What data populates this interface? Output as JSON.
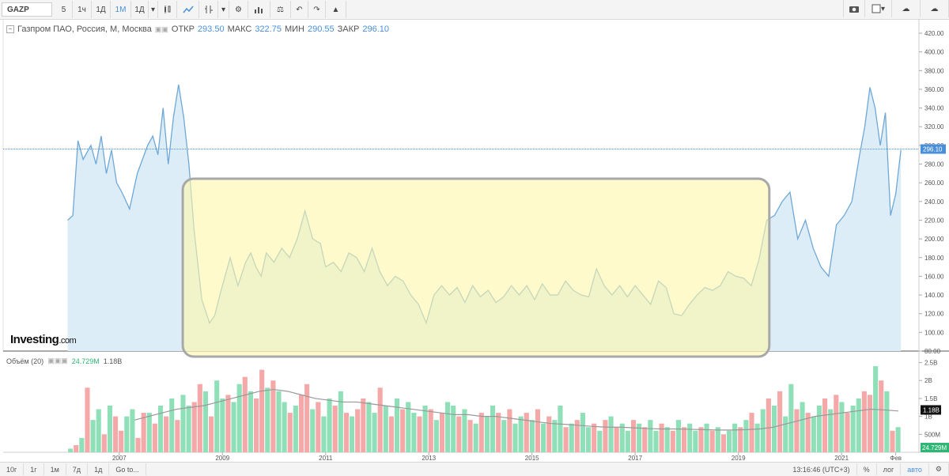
{
  "toolbar": {
    "symbol": "GAZP",
    "intervals": [
      "5",
      "1ч",
      "1Д",
      "1М",
      "1Д"
    ],
    "active_interval": "1М",
    "icons": [
      "candles-icon",
      "line-chart-icon",
      "indicators-icon",
      "settings-icon",
      "studies-icon",
      "compare-icon",
      "undo-icon",
      "redo-icon",
      "alert-icon"
    ],
    "right_icons": [
      "camera-icon",
      "layout-icon",
      "cloud-load-icon",
      "cloud-save-icon"
    ]
  },
  "legend": {
    "name": "Газпром ПАО, Россия, М, Москва",
    "open_label": "ОТКР",
    "open": "293.50",
    "high_label": "МАКС",
    "high": "322.75",
    "low_label": "МИН",
    "low": "290.55",
    "close_label": "ЗАКР",
    "close": "296.10"
  },
  "volume_legend": {
    "name": "Объём (20)",
    "value1": "24.729M",
    "value2": "1.18B"
  },
  "brand": {
    "main": "Investing",
    "suffix": ".com"
  },
  "bottom": {
    "ranges": [
      "10г",
      "1г",
      "1м",
      "7д",
      "1д",
      "Go to..."
    ],
    "time": "13:16:46 (UTC+3)",
    "percent": "%",
    "log": "лог",
    "auto": "авто"
  },
  "colors": {
    "line": "#6fa8d6",
    "area": "#dcedf8",
    "highlight_fill": "#fff6a8",
    "highlight_border": "#a8a8a8",
    "vol_up": "#8fe0b8",
    "vol_down": "#f5a8a8",
    "vol_ma": "#999999",
    "price_tag": "#4a90d9"
  },
  "chart_data": [
    {
      "type": "area",
      "title": "Газпром ПАО, Россия, М, Москва",
      "ylim": [
        80,
        420
      ],
      "y_ticks": [
        "80.00",
        "100.00",
        "120.00",
        "140.00",
        "160.00",
        "180.00",
        "200.00",
        "220.00",
        "240.00",
        "260.00",
        "280.00",
        "300.00",
        "320.00",
        "340.00",
        "360.00",
        "380.00",
        "400.00",
        "420.00"
      ],
      "x_ticks": [
        "2007",
        "2009",
        "2011",
        "2013",
        "2015",
        "2017",
        "2019",
        "2021",
        "Фев"
      ],
      "current_value": "296.10",
      "highlight_region": {
        "x_from": 2008.2,
        "x_to": 2019.6
      },
      "series": [
        {
          "x": [
            2006.0,
            2006.1,
            2006.2,
            2006.3,
            2006.45,
            2006.55,
            2006.65,
            2006.75,
            2006.85,
            2006.95,
            2007.05,
            2007.2,
            2007.35,
            2007.45,
            2007.55,
            2007.65,
            2007.75,
            2007.85,
            2007.95,
            2008.05,
            2008.15,
            2008.25,
            2008.35,
            2008.45,
            2008.6,
            2008.75,
            2008.85,
            2008.95,
            2009.05,
            2009.15,
            2009.3,
            2009.45,
            2009.55,
            2009.65,
            2009.75,
            2009.85,
            2010.0,
            2010.15,
            2010.3,
            2010.45,
            2010.6,
            2010.75,
            2010.9,
            2011.0,
            2011.15,
            2011.3,
            2011.45,
            2011.6,
            2011.75,
            2011.9,
            2012.05,
            2012.2,
            2012.35,
            2012.5,
            2012.65,
            2012.8,
            2012.95,
            2013.1,
            2013.25,
            2013.4,
            2013.55,
            2013.7,
            2013.85,
            2014.0,
            2014.15,
            2014.3,
            2014.45,
            2014.6,
            2014.75,
            2014.9,
            2015.05,
            2015.2,
            2015.35,
            2015.5,
            2015.65,
            2015.8,
            2015.95,
            2016.1,
            2016.25,
            2016.4,
            2016.55,
            2016.7,
            2016.85,
            2017.0,
            2017.15,
            2017.3,
            2017.45,
            2017.6,
            2017.75,
            2017.9,
            2018.05,
            2018.2,
            2018.35,
            2018.5,
            2018.65,
            2018.8,
            2018.95,
            2019.1,
            2019.25,
            2019.4,
            2019.55,
            2019.7,
            2019.85,
            2020.0,
            2020.15,
            2020.3,
            2020.45,
            2020.6,
            2020.75,
            2020.9,
            2021.05,
            2021.2,
            2021.35,
            2021.45,
            2021.55,
            2021.65,
            2021.75,
            2021.85,
            2021.95,
            2022.05,
            2022.15
          ],
          "y": [
            220,
            225,
            305,
            285,
            300,
            280,
            310,
            270,
            295,
            260,
            250,
            232,
            270,
            285,
            300,
            310,
            290,
            340,
            280,
            330,
            365,
            330,
            280,
            210,
            135,
            110,
            118,
            140,
            160,
            180,
            150,
            175,
            185,
            170,
            160,
            185,
            175,
            190,
            180,
            200,
            230,
            200,
            195,
            170,
            175,
            165,
            185,
            180,
            165,
            190,
            165,
            150,
            160,
            155,
            140,
            130,
            110,
            140,
            150,
            140,
            148,
            132,
            150,
            138,
            145,
            132,
            138,
            150,
            140,
            150,
            135,
            152,
            140,
            140,
            155,
            145,
            140,
            138,
            168,
            150,
            140,
            150,
            138,
            150,
            140,
            130,
            155,
            148,
            120,
            118,
            130,
            140,
            148,
            145,
            150,
            165,
            160,
            158,
            150,
            178,
            220,
            225,
            240,
            250,
            200,
            220,
            190,
            170,
            160,
            215,
            225,
            240,
            290,
            320,
            362,
            340,
            300,
            335,
            225,
            248,
            295
          ]
        }
      ]
    },
    {
      "type": "bar",
      "title": "Объём (20)",
      "ylim": [
        0,
        2.6
      ],
      "y_ticks": [
        "500M",
        "1B",
        "1.5B",
        "2B",
        "2.5B"
      ],
      "values": [
        0.1,
        0.2,
        0.4,
        1.8,
        0.9,
        1.2,
        0.5,
        1.3,
        1.0,
        0.6,
        1.0,
        1.2,
        0.4,
        1.1,
        1.1,
        0.8,
        1.3,
        1.0,
        1.5,
        0.9,
        1.6,
        1.3,
        1.4,
        1.9,
        1.7,
        1.0,
        2.0,
        1.5,
        1.6,
        1.4,
        1.9,
        2.1,
        1.7,
        1.5,
        2.3,
        1.8,
        2.0,
        1.7,
        1.4,
        1.1,
        1.3,
        1.6,
        1.9,
        1.2,
        1.4,
        1.0,
        1.5,
        1.3,
        1.7,
        1.1,
        1.0,
        1.2,
        1.5,
        1.4,
        1.1,
        1.8,
        1.3,
        1.0,
        1.5,
        1.2,
        1.4,
        1.1,
        1.0,
        1.3,
        1.2,
        0.9,
        1.1,
        1.4,
        1.3,
        1.0,
        1.2,
        0.9,
        0.8,
        1.1,
        1.0,
        1.3,
        1.1,
        0.9,
        1.2,
        0.8,
        1.0,
        1.1,
        0.9,
        1.2,
        0.8,
        1.0,
        0.9,
        1.3,
        0.7,
        0.8,
        0.9,
        1.1,
        0.7,
        0.8,
        0.6,
        0.9,
        1.0,
        0.7,
        0.8,
        0.6,
        0.9,
        0.8,
        0.7,
        0.9,
        0.6,
        0.8,
        0.7,
        0.6,
        0.9,
        0.7,
        0.8,
        0.6,
        0.7,
        0.8,
        0.6,
        0.7,
        0.5,
        0.6,
        0.8,
        0.7,
        0.9,
        1.1,
        0.8,
        1.2,
        1.5,
        1.3,
        1.7,
        1.0,
        1.9,
        1.2,
        1.4,
        1.1,
        1.0,
        1.3,
        1.5,
        1.2,
        1.6,
        1.4,
        1.1,
        1.3,
        1.5,
        1.7,
        1.6,
        2.4,
        2.0,
        1.7,
        0.6,
        0.7
      ],
      "up": [
        1,
        0,
        1,
        0,
        1,
        1,
        0,
        1,
        0,
        0,
        1,
        1,
        0,
        0,
        1,
        0,
        1,
        0,
        1,
        0,
        1,
        1,
        0,
        0,
        1,
        0,
        1,
        1,
        0,
        1,
        1,
        0,
        1,
        0,
        0,
        1,
        0,
        1,
        1,
        0,
        1,
        0,
        0,
        1,
        0,
        1,
        1,
        0,
        1,
        0,
        1,
        0,
        0,
        1,
        1,
        0,
        1,
        0,
        1,
        0,
        1,
        1,
        0,
        1,
        0,
        1,
        0,
        1,
        1,
        0,
        1,
        0,
        1,
        0,
        1,
        1,
        0,
        1,
        0,
        1,
        1,
        0,
        1,
        0,
        1,
        0,
        1,
        1,
        0,
        1,
        0,
        1,
        1,
        0,
        1,
        0,
        1,
        0,
        1,
        1,
        0,
        1,
        0,
        1,
        1,
        0,
        1,
        0,
        1,
        0,
        1,
        1,
        0,
        1,
        0,
        1,
        0,
        1,
        1,
        0,
        1,
        0,
        1,
        1,
        0,
        1,
        0,
        1,
        1,
        0,
        1,
        0,
        1,
        1,
        0,
        1,
        0,
        1,
        0,
        1,
        1,
        0,
        0,
        1,
        0
      ],
      "ma": [
        0.9,
        1.0,
        1.1,
        1.2,
        1.25,
        1.3,
        1.4,
        1.5,
        1.6,
        1.7,
        1.75,
        1.7,
        1.6,
        1.5,
        1.45,
        1.4,
        1.4,
        1.35,
        1.3,
        1.25,
        1.2,
        1.15,
        1.1,
        1.05,
        1.05,
        1.0,
        1.0,
        0.95,
        0.9,
        0.85,
        0.8,
        0.78,
        0.75,
        0.72,
        0.7,
        0.7,
        0.68,
        0.66,
        0.65,
        0.65,
        0.64,
        0.63,
        0.62,
        0.62,
        0.63,
        0.65,
        0.7,
        0.8,
        0.9,
        1.0,
        1.05,
        1.1,
        1.15,
        1.2,
        1.18,
        1.15
      ]
    }
  ]
}
